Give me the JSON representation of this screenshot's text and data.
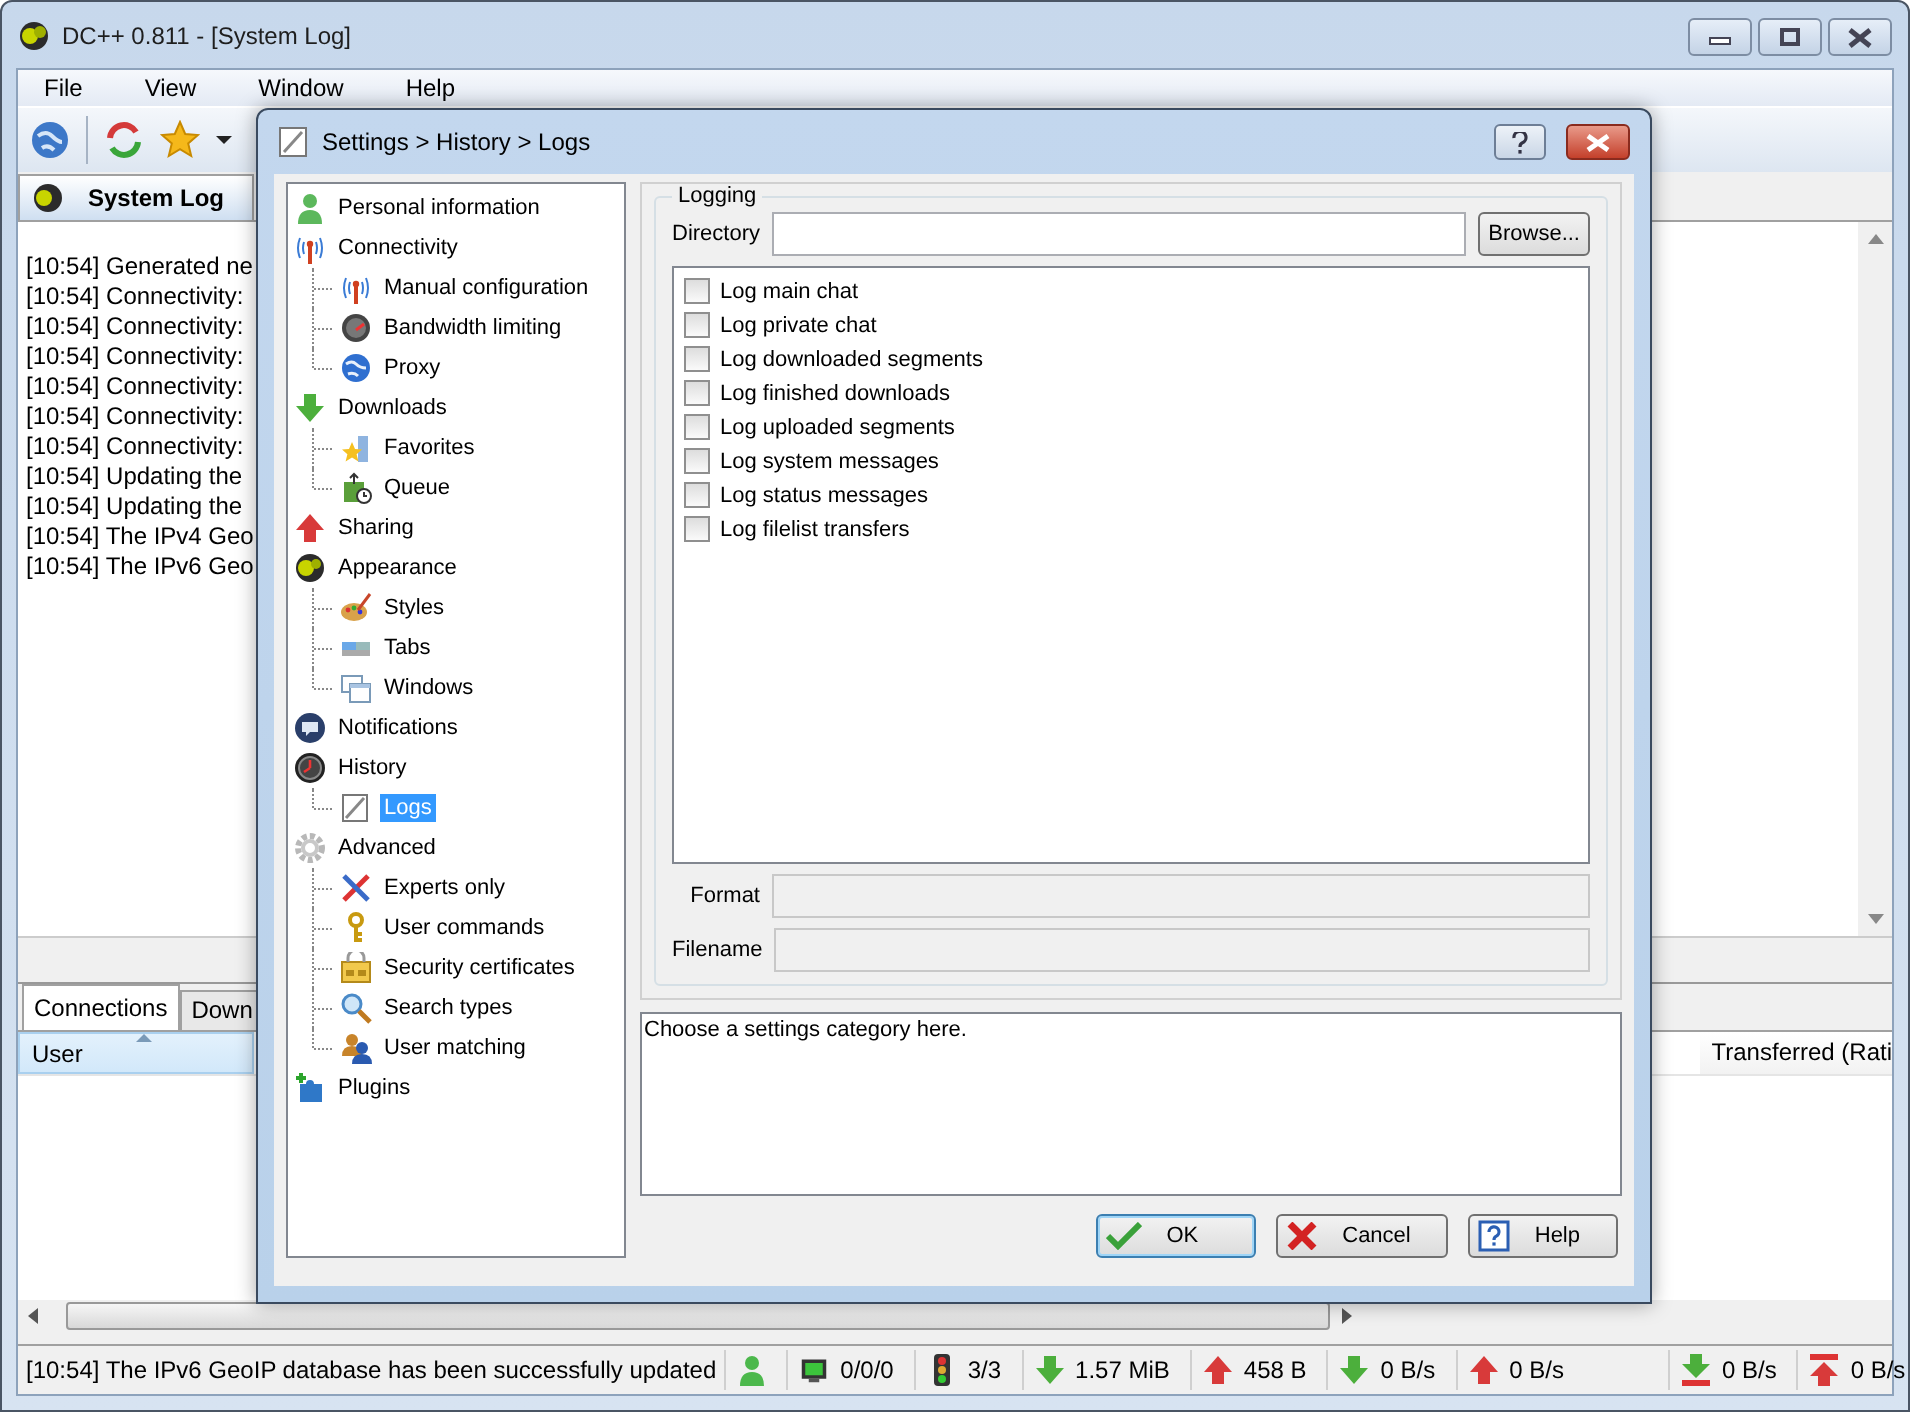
{
  "window": {
    "title": "DC++ 0.811 - [System Log]"
  },
  "menu": [
    "File",
    "View",
    "Window",
    "Help"
  ],
  "tabs": [
    {
      "label": "System Log",
      "selected": true
    }
  ],
  "log_lines": [
    "[10:54] Generated ne",
    "[10:54] Connectivity:",
    "[10:54] Connectivity:",
    "[10:54] Connectivity:",
    "[10:54] Connectivity:",
    "[10:54] Connectivity:",
    "[10:54] Connectivity:",
    "[10:54] Updating the",
    "[10:54] Updating the",
    "[10:54] The IPv4 Geo",
    "[10:54] The IPv6 Geo"
  ],
  "bottom_tabs": [
    {
      "label": "Connections",
      "selected": true
    },
    {
      "label": "Down",
      "selected": false
    }
  ],
  "table": {
    "columns": [
      {
        "label": "User",
        "sorted": true
      },
      {
        "label": "Transferred (Rati",
        "sorted": false
      }
    ]
  },
  "status_bar": {
    "message": "[10:54] The IPv6 GeoIP database has been successfully updated",
    "items": [
      {
        "kind": "user"
      },
      {
        "kind": "hubs",
        "text": "0/0/0"
      },
      {
        "kind": "slots",
        "text": "3/3"
      },
      {
        "kind": "downloaded",
        "text": "1.57 MiB"
      },
      {
        "kind": "uploaded",
        "text": "458 B"
      },
      {
        "kind": "down-rate",
        "text": "0 B/s"
      },
      {
        "kind": "up-rate",
        "text": "0 B/s"
      },
      {
        "kind": "down-limit",
        "text": "0 B/s"
      },
      {
        "kind": "up-limit",
        "text": "0 B/s"
      }
    ]
  },
  "dialog": {
    "title": "Settings > History > Logs",
    "tree": [
      {
        "label": "Personal information",
        "kind": "person",
        "selected": false
      },
      {
        "label": "Connectivity",
        "kind": "antenna",
        "selected": false,
        "children": [
          {
            "label": "Manual configuration",
            "kind": "antenna",
            "selected": false
          },
          {
            "label": "Bandwidth limiting",
            "kind": "gauge",
            "selected": false
          },
          {
            "label": "Proxy",
            "kind": "globe",
            "selected": false
          }
        ]
      },
      {
        "label": "Downloads",
        "kind": "down",
        "selected": false,
        "children": [
          {
            "label": "Favorites",
            "kind": "star",
            "selected": false
          },
          {
            "label": "Queue",
            "kind": "queue",
            "selected": false
          }
        ]
      },
      {
        "label": "Sharing",
        "kind": "up",
        "selected": false
      },
      {
        "label": "Appearance",
        "kind": "ball",
        "selected": false,
        "children": [
          {
            "label": "Styles",
            "kind": "palette",
            "selected": false
          },
          {
            "label": "Tabs",
            "kind": "tabs",
            "selected": false
          },
          {
            "label": "Windows",
            "kind": "windows",
            "selected": false
          }
        ]
      },
      {
        "label": "Notifications",
        "kind": "bubble",
        "selected": false
      },
      {
        "label": "History",
        "kind": "clock",
        "selected": false,
        "children": [
          {
            "label": "Logs",
            "kind": "page",
            "selected": true
          }
        ]
      },
      {
        "label": "Advanced",
        "kind": "gear",
        "selected": false,
        "children": [
          {
            "label": "Experts only",
            "kind": "tools",
            "selected": false
          },
          {
            "label": "User commands",
            "kind": "key",
            "selected": false
          },
          {
            "label": "Security certificates",
            "kind": "cert",
            "selected": false
          },
          {
            "label": "Search types",
            "kind": "search",
            "selected": false
          },
          {
            "label": "User matching",
            "kind": "users",
            "selected": false
          }
        ]
      },
      {
        "label": "Plugins",
        "kind": "plugin",
        "selected": false
      }
    ],
    "group": {
      "title": "Logging",
      "directory_label": "Directory",
      "browse": "Browse...",
      "options": [
        {
          "label": "Log main chat",
          "checked": false
        },
        {
          "label": "Log private chat",
          "checked": false
        },
        {
          "label": "Log downloaded segments",
          "checked": false
        },
        {
          "label": "Log finished downloads",
          "checked": false
        },
        {
          "label": "Log uploaded segments",
          "checked": false
        },
        {
          "label": "Log system messages",
          "checked": false
        },
        {
          "label": "Log status messages",
          "checked": false
        },
        {
          "label": "Log filelist transfers",
          "checked": false
        }
      ],
      "fields": [
        {
          "label": "Format",
          "disabled": true
        },
        {
          "label": "Filename",
          "disabled": true
        }
      ]
    },
    "description": "Choose a settings category here.",
    "buttons": [
      {
        "kind": "ok",
        "label": "OK",
        "selected": true
      },
      {
        "kind": "cancel",
        "label": "Cancel",
        "selected": false
      },
      {
        "kind": "help",
        "label": "Help",
        "selected": false
      }
    ]
  }
}
